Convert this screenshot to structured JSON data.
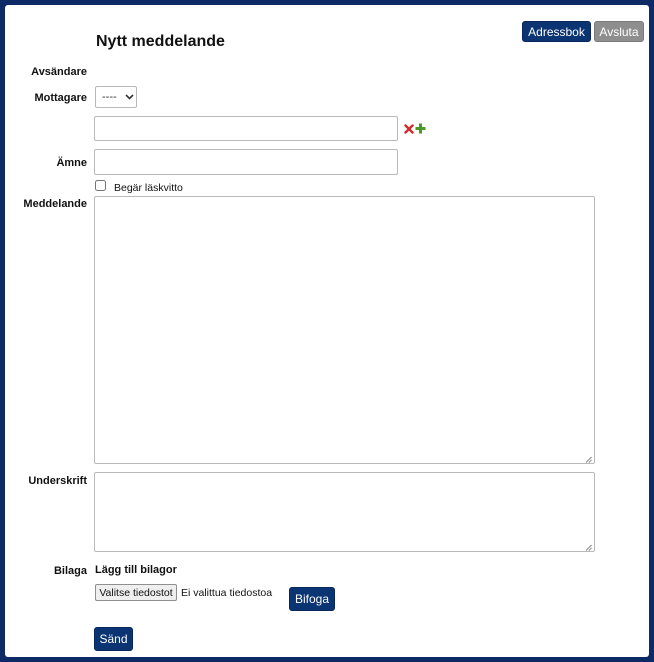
{
  "header": {
    "title": "Nytt meddelande",
    "address_book_label": "Adressbok",
    "quit_label": "Avsluta"
  },
  "form": {
    "sender_label": "Avsändare",
    "recipient_label": "Mottagare",
    "recipient_select_value": "----",
    "recipient_input_value": "",
    "subject_label": "Ämne",
    "subject_value": "",
    "read_receipt_label": "Begär läskvitto",
    "read_receipt_checked": false,
    "message_label": "Meddelande",
    "message_value": "",
    "signature_label": "Underskrift",
    "signature_value": "",
    "attachment_label": "Bilaga",
    "add_attachments_text": "Lägg till bilagor",
    "choose_file_label": "Valitse tiedostot",
    "no_file_text": "Ei valittua tiedostoa",
    "attach_button_label": "Bifoga",
    "send_button_label": "Sänd"
  },
  "icons": {
    "remove_recipient": "remove-x-icon",
    "add_recipient": "add-plus-icon"
  },
  "colors": {
    "background_frame": "#0d2a66",
    "primary_button": "#0b3473",
    "secondary_button": "#8e8e8e",
    "remove_icon": "#d22b2b",
    "add_icon": "#4a9a2a"
  }
}
